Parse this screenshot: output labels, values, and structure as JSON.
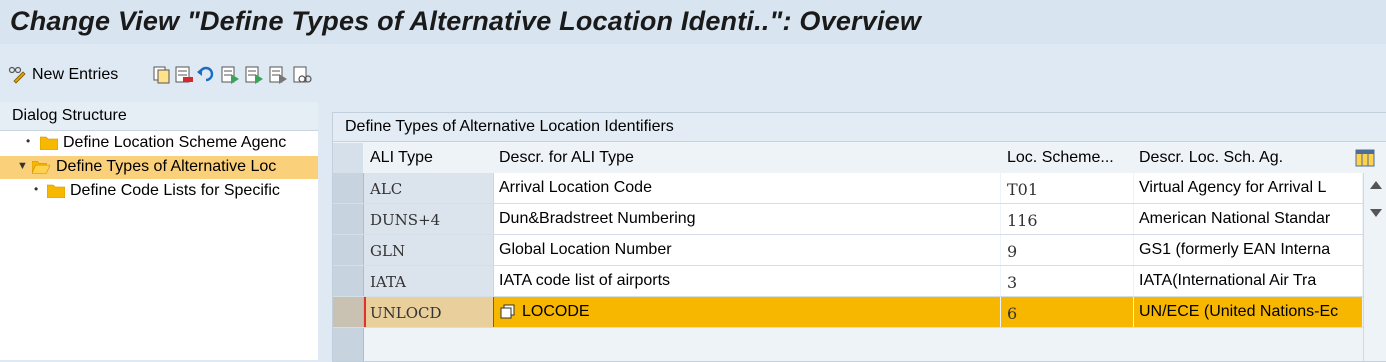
{
  "title": "Change View \"Define Types of Alternative Location Identi..\": Overview",
  "toolbar": {
    "new_entries": "New Entries",
    "icons": [
      "edit-glasses-icon",
      "copy-icon",
      "delete-icon",
      "undo-icon",
      "select-all-icon",
      "select-block-icon",
      "deselect-all-icon",
      "print-preview-icon"
    ]
  },
  "dialog_structure": {
    "header": "Dialog Structure",
    "items": [
      {
        "label": "Define Location Scheme Agenc",
        "expanded": false,
        "selected": false
      },
      {
        "label": "Define Types of Alternative Loc",
        "expanded": true,
        "selected": true
      },
      {
        "label": "Define Code Lists for Specific",
        "expanded": false,
        "selected": false
      }
    ]
  },
  "table": {
    "title": "Define Types of Alternative Location Identifiers",
    "columns": [
      "ALI Type",
      "Descr. for ALI Type",
      "Loc. Scheme...",
      "Descr. Loc. Sch. Ag."
    ],
    "rows": [
      {
        "type": "ALC",
        "descr": "Arrival Location Code",
        "scheme": "T01",
        "agency": "Virtual Agency for Arrival L"
      },
      {
        "type": "DUNS+4",
        "descr": "Dun&Bradstreet Numbering",
        "scheme": "116",
        "agency": "American National Standar"
      },
      {
        "type": "GLN",
        "descr": "Global Location Number",
        "scheme": "9",
        "agency": "GS1 (formerly EAN Interna"
      },
      {
        "type": "IATA",
        "descr": "IATA code list of airports",
        "scheme": "3",
        "agency": "IATA(International Air Tra"
      },
      {
        "type": "UNLOCD",
        "descr": "LOCODE",
        "scheme": "6",
        "agency": "UN/ECE (United Nations-Ec"
      }
    ]
  },
  "colors": {
    "highlight": "#f7b700",
    "selected_tree": "#fbd07a",
    "folder": "#f9b800"
  }
}
